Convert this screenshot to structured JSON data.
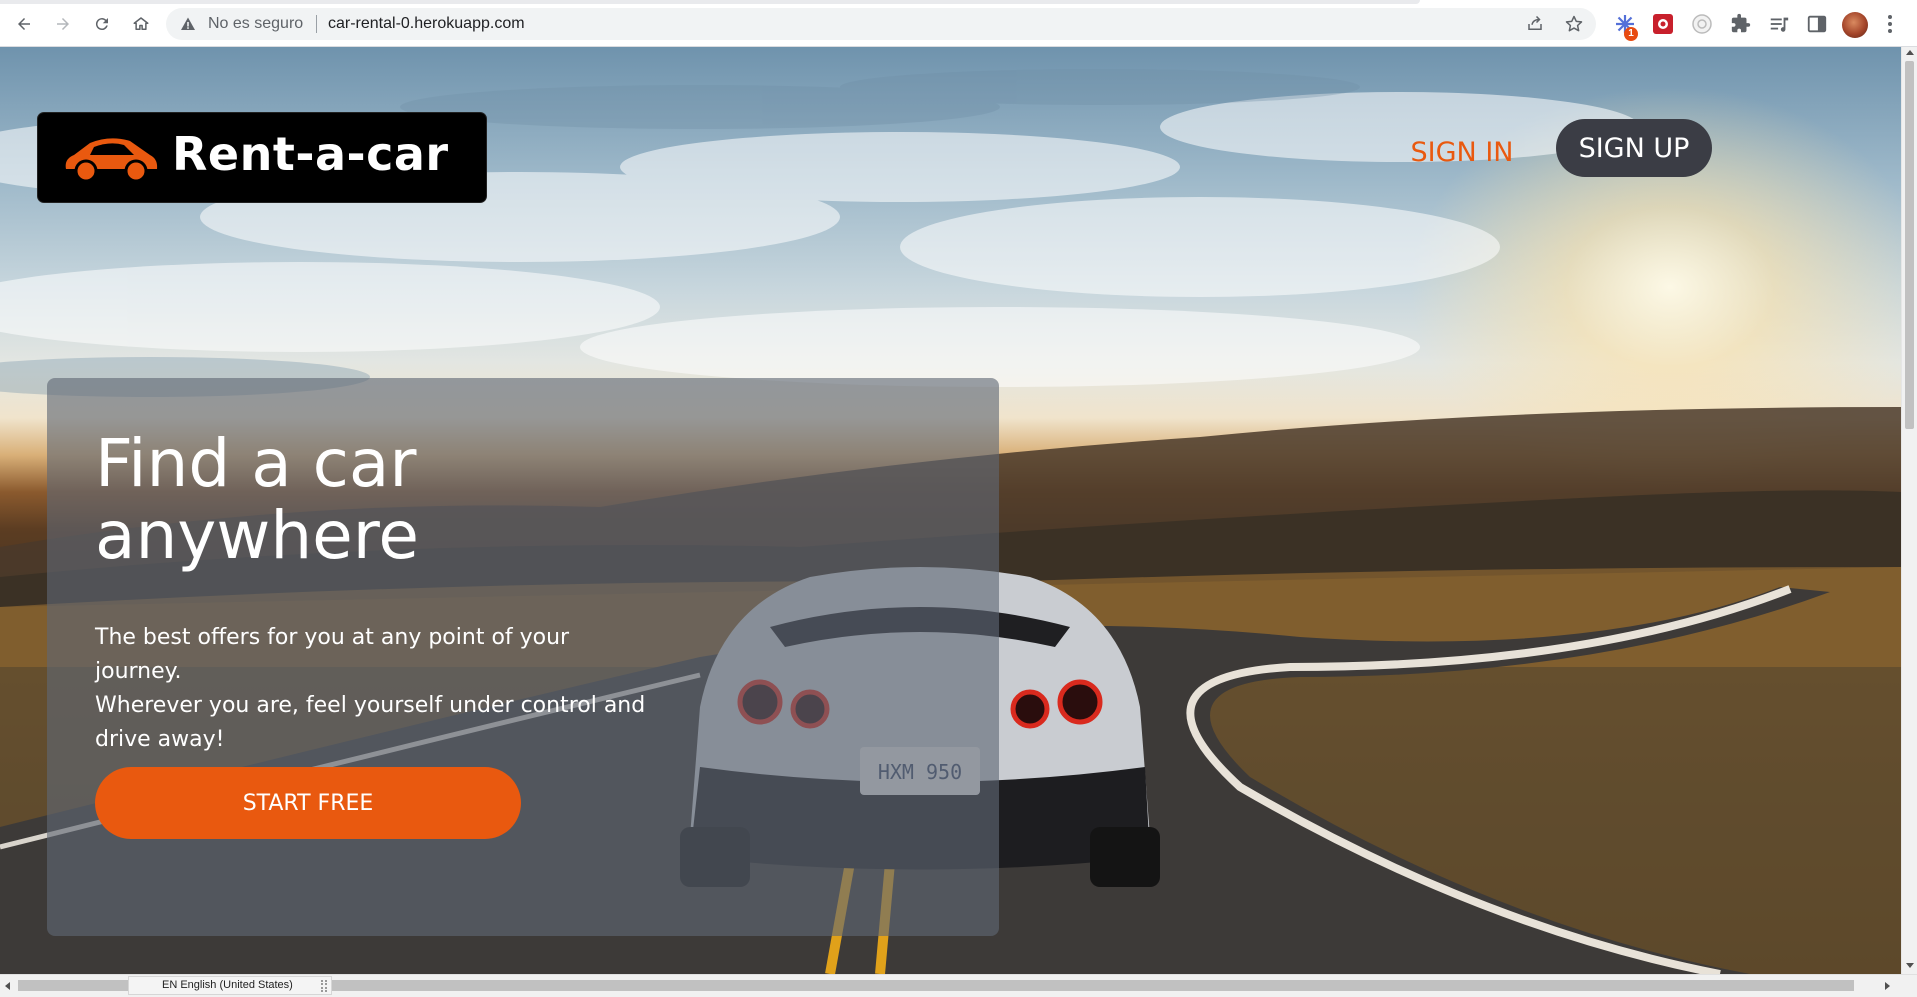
{
  "browser": {
    "security_label": "No es seguro",
    "url": "car-rental-0.herokuapp.com",
    "extension_badge": "1"
  },
  "header": {
    "logo_text": "Rent-a-car",
    "sign_in_label": "SIGN IN",
    "sign_up_label": "SIGN UP"
  },
  "hero": {
    "title_line1": "Find a car",
    "title_line2": "anywhere",
    "text_line1": "The best offers for you at any point of your journey.",
    "text_line2": "Wherever you are, feel yourself under control and",
    "text_line3": "drive away!",
    "cta_label": "START FREE"
  },
  "statusbar": {
    "language_indicator": "EN English (United States)"
  },
  "colors": {
    "accent": "#e9590f",
    "signup_bg": "#3b3d45",
    "logo_bg": "#000000"
  },
  "icons": [
    "back-arrow-icon",
    "forward-arrow-icon",
    "reload-icon",
    "home-icon",
    "warning-icon",
    "share-icon",
    "star-icon",
    "extension-icon",
    "puzzle-icon",
    "media-icon",
    "sidebar-icon",
    "avatar",
    "kebab-menu-icon",
    "car-logo-icon"
  ]
}
